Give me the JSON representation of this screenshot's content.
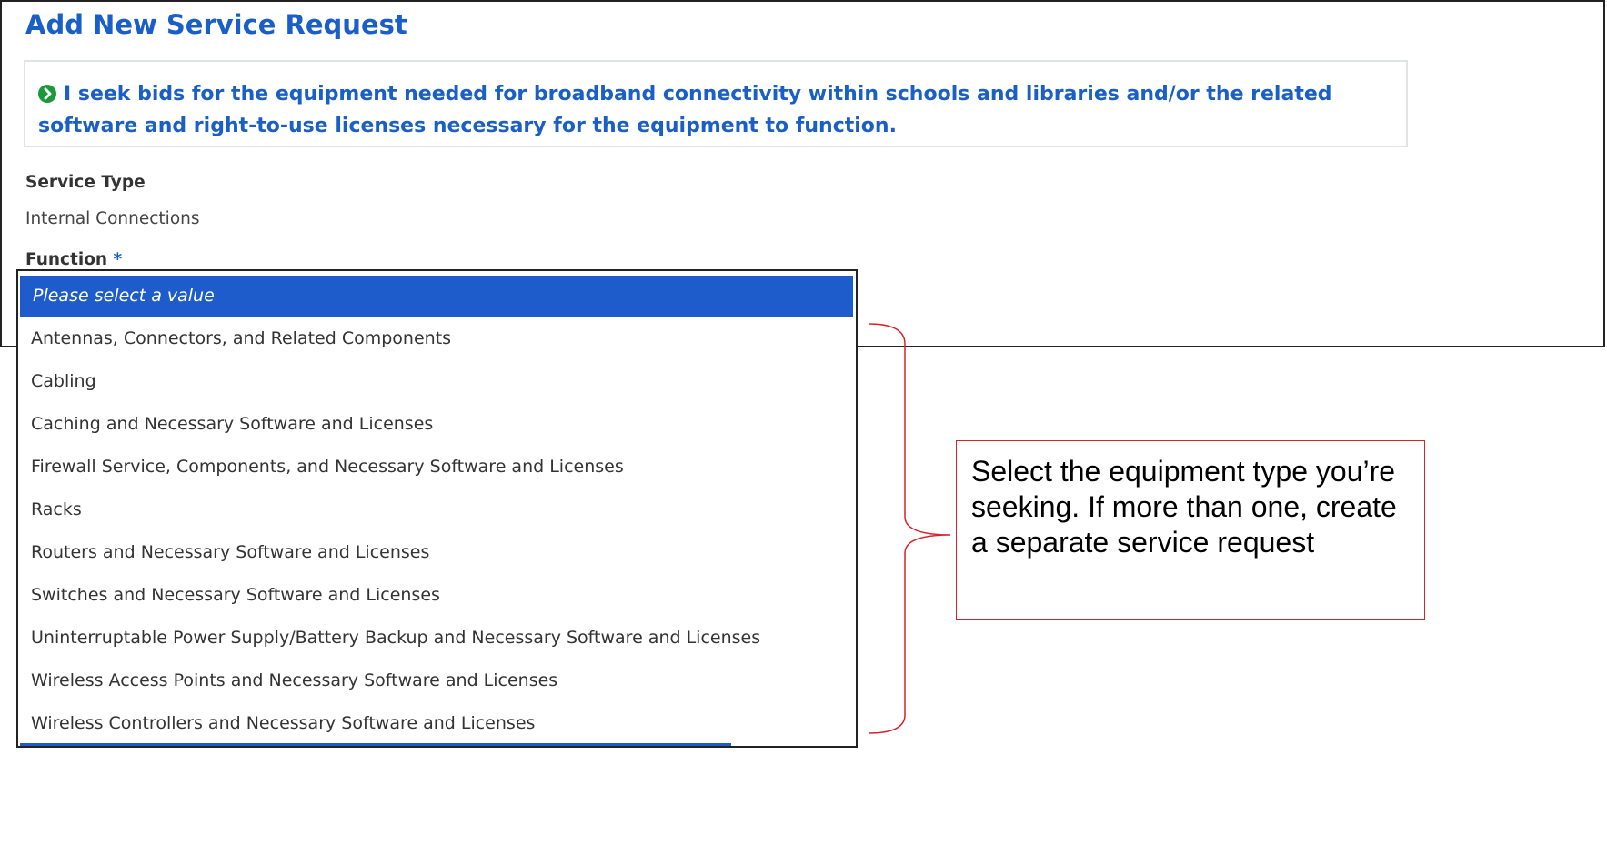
{
  "page": {
    "title": "Add New Service Request"
  },
  "notice": {
    "icon": "circle-arrow-right-icon",
    "icon_color": "#1a9a3a",
    "text": "I seek bids for the equipment needed for broadband connectivity within schools and libraries and/or the related software and right-to-use licenses necessary for the equipment to function."
  },
  "service_type": {
    "label": "Service Type",
    "value": "Internal Connections"
  },
  "function": {
    "label": "Function",
    "required_marker": "*",
    "placeholder": "Please select a value",
    "options": [
      "Antennas, Connectors, and Related Components",
      "Cabling",
      "Caching and Necessary Software and Licenses",
      "Firewall Service, Components, and Necessary Software and Licenses",
      "Racks",
      "Routers and Necessary Software and Licenses",
      "Switches and Necessary Software and Licenses",
      "Uninterruptable Power Supply/Battery Backup and Necessary Software and Licenses",
      "Wireless Access Points and Necessary Software and Licenses",
      "Wireless Controllers and Necessary Software and Licenses"
    ]
  },
  "annotation": {
    "text": "Select the equipment type you’re seeking. If more than one, create a separate service request",
    "border_color": "#d9202c"
  },
  "colors": {
    "accent_blue": "#1a5fc8",
    "selection_blue": "#1e5ccc"
  }
}
